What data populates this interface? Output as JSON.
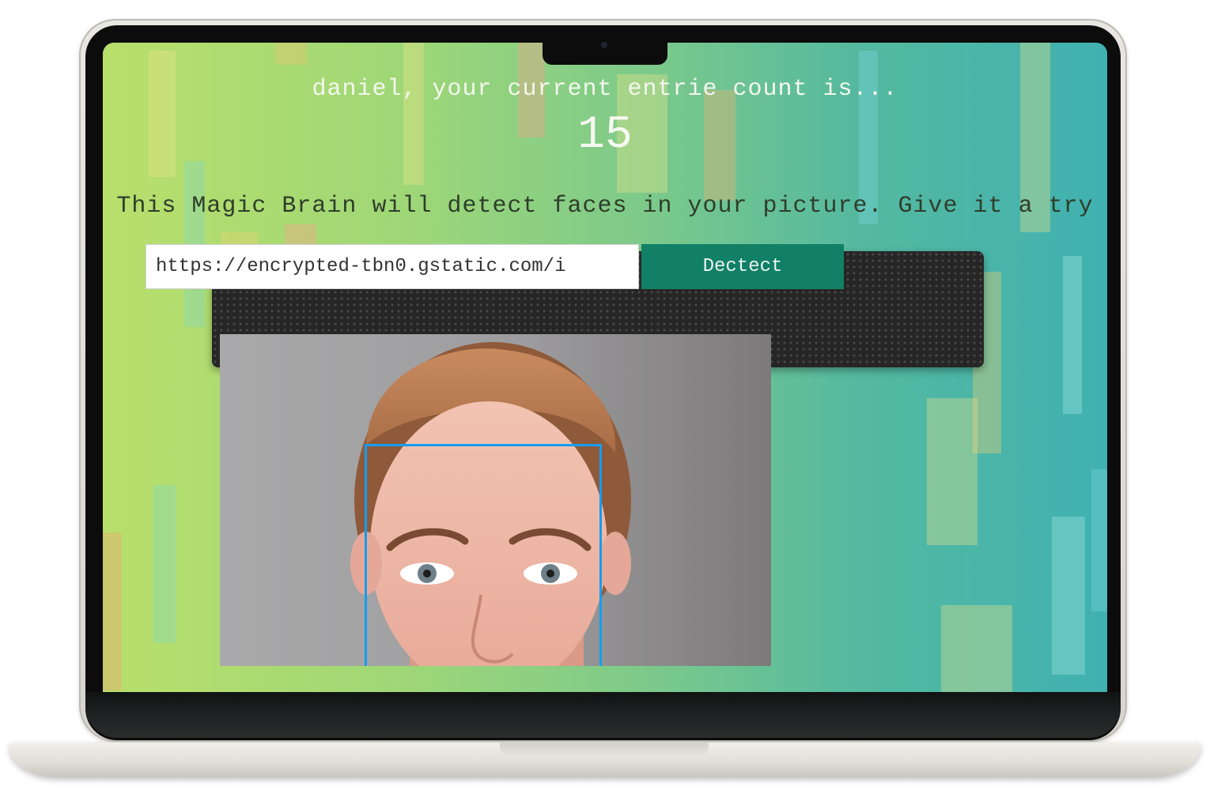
{
  "greeting": "daniel, your current entrie count is...",
  "entry_count": "15",
  "tagline": "This Magic Brain will detect faces in your picture. Give it a try",
  "image_form": {
    "url_value": "https://encrypted-tbn0.gstatic.com/i",
    "detect_label": "Dectect"
  },
  "colors": {
    "detect_button": "#118066",
    "face_box": "#149df2",
    "form_panel": "#262626"
  },
  "icons": [
    "camera-icon"
  ]
}
